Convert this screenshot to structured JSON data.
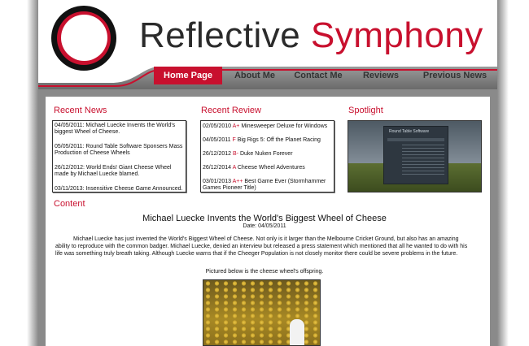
{
  "site": {
    "title_part1": "Reflective ",
    "title_part2": "Symphony",
    "accent_color": "#c8102e"
  },
  "nav": {
    "items": [
      {
        "label": "Home Page",
        "active": true
      },
      {
        "label": "About Me",
        "active": false
      },
      {
        "label": "Contact Me",
        "active": false
      },
      {
        "label": "Reviews",
        "active": false
      },
      {
        "label": "Previous News",
        "active": false
      }
    ]
  },
  "recent_news": {
    "title": "Recent News",
    "items": [
      "04/05/2011: Michael Luecke Invents the World's biggest Wheel of Cheese.",
      "05/05/2011: Round Table Software Sponsers Mass Production of Cheese Wheels",
      "26/12/2012: World Ends! Giant Cheese Wheel made by Michael Luecke blamed.",
      "03/11/2013: Insensitive Cheese Game Announced."
    ]
  },
  "recent_review": {
    "title": "Recent Review",
    "items": [
      {
        "date": "02/05/2010",
        "grade": "A+",
        "name": "Minesweeper Deluxe for Windows"
      },
      {
        "date": "04/05/2011",
        "grade": "F",
        "name": "Big Rigs 5: Off the Planet Racing"
      },
      {
        "date": "26/12/2012",
        "grade": "B-",
        "name": "Duke Nuken Forever"
      },
      {
        "date": "26/12/2014",
        "grade": "A",
        "name": "Cheese Wheel Adventures"
      },
      {
        "date": "03/01/2013",
        "grade": "A++",
        "name": "Best Game Ever (Stormhammer Games Pioneer Title)"
      }
    ]
  },
  "spotlight": {
    "title": "Spotlight",
    "window_title": "Round Table Software"
  },
  "content": {
    "section_title": "Content",
    "article_title": "Michael Luecke Invents the World's Biggest Wheel of Cheese",
    "article_date": "Date: 04/05/2011",
    "article_body": "Michael Luecke has just invented the World's Biggest Wheel of Cheese.  Not only is it larger than the Melbourne Cricket Ground, but also has  an amazing ability to reproduce with the common badger.  Michael Luecke, denied an interview but released a press statement which mentioned that all he wanted to do with his life was something truly breath taking.  Although Luecke warns that if the Cheeger Population is not closely monitor there could be severe problems in the future.",
    "caption": "Pictured below is the cheese wheel's offspring."
  }
}
